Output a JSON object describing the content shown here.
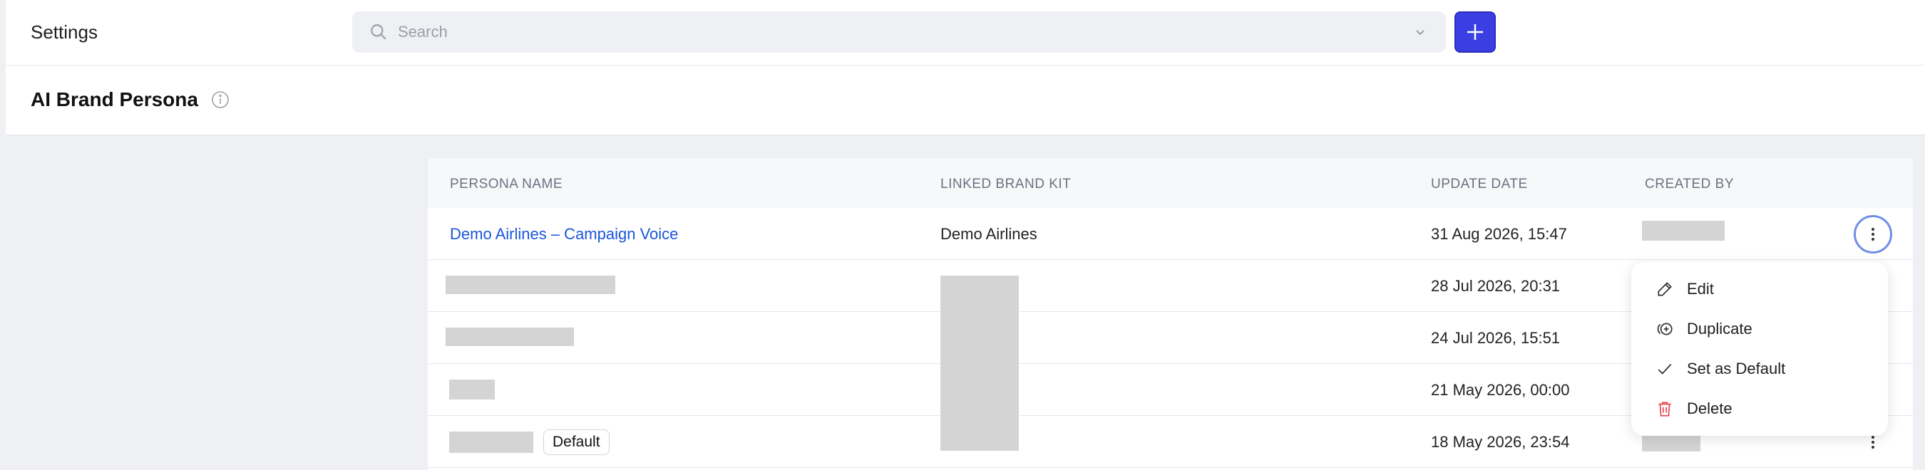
{
  "topbar": {
    "title": "Settings",
    "search_placeholder": "Search",
    "search_value": ""
  },
  "page": {
    "title": "AI Brand Persona"
  },
  "table": {
    "headers": {
      "persona_name": "PERSONA NAME",
      "linked_brand_kit": "LINKED BRAND KIT",
      "update_date": "UPDATE DATE",
      "created_by": "CREATED BY"
    },
    "rows": [
      {
        "persona_name": "Demo Airlines – Campaign Voice",
        "linked_brand_kit": "Demo Airlines",
        "update_date": "31 Aug 2026, 15:47"
      },
      {
        "persona_name": "",
        "linked_brand_kit": "",
        "update_date": "28 Jul 2026, 20:31"
      },
      {
        "persona_name": "",
        "linked_brand_kit": "",
        "update_date": "24 Jul 2026, 15:51"
      },
      {
        "persona_name": "",
        "linked_brand_kit": "",
        "update_date": "21 May 2026, 00:00"
      },
      {
        "persona_name": "",
        "linked_brand_kit": "",
        "update_date": "18 May 2026, 23:54",
        "badge": "Default"
      }
    ]
  },
  "menu": {
    "items": [
      {
        "label": "Edit",
        "icon": "pencil-icon"
      },
      {
        "label": "Duplicate",
        "icon": "duplicate-icon"
      },
      {
        "label": "Set as Default",
        "icon": "check-icon"
      },
      {
        "label": "Delete",
        "icon": "trash-icon"
      }
    ]
  },
  "colors": {
    "accent": "#3b3fe3",
    "link": "#1a56db",
    "delete": "#e5484d",
    "background": "#eef0f3"
  }
}
